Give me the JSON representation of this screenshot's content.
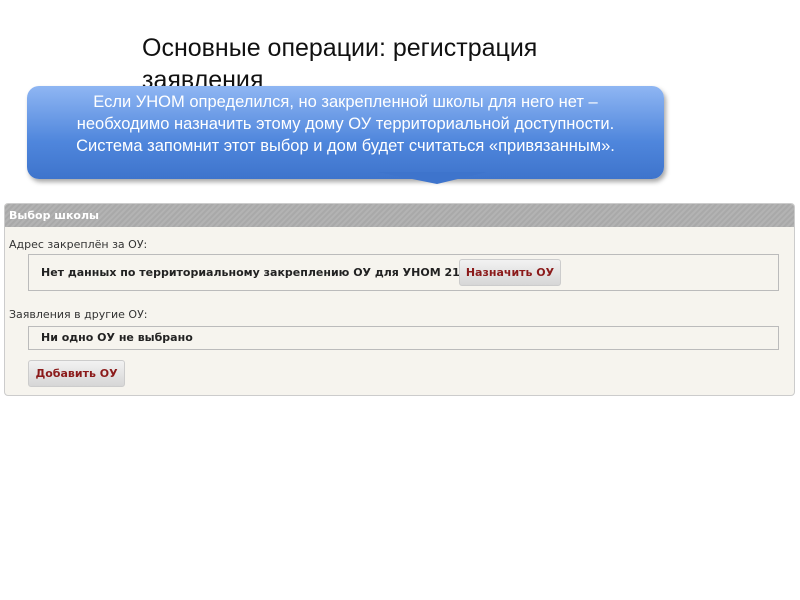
{
  "slide_title": "Основные операции: регистрация заявления",
  "callout_text": "Если УНОМ определился, но закрепленной школы для него нет – необходимо назначить этому дому ОУ территориальной доступности. Система запомнит этот выбор и дом будет считаться «привязанным».",
  "panel": {
    "title": "Выбор школы",
    "assigned_label": "Адрес закреплён за ОУ:",
    "assigned_text": "Нет данных по территориальному закреплению ОУ для УНОМ 2117064.",
    "assign_button": "Назначить ОУ",
    "other_label": "Заявления в другие ОУ:",
    "other_text": "Ни одно ОУ не выбрано",
    "add_button": "Добавить ОУ"
  }
}
